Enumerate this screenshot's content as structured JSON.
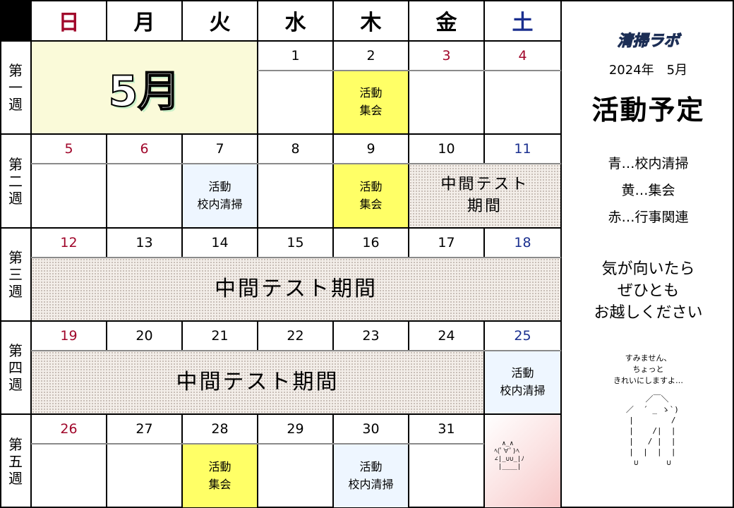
{
  "weekdays": [
    "日",
    "月",
    "火",
    "水",
    "木",
    "金",
    "土"
  ],
  "month_label": "5月",
  "week_labels": [
    [
      "第",
      "一",
      "週"
    ],
    [
      "第",
      "二",
      "週"
    ],
    [
      "第",
      "三",
      "週"
    ],
    [
      "第",
      "四",
      "週"
    ],
    [
      "第",
      "五",
      "週"
    ]
  ],
  "dates": {
    "w1": [
      "1",
      "2",
      "3",
      "4"
    ],
    "w2": [
      "5",
      "6",
      "7",
      "8",
      "9",
      "10",
      "11"
    ],
    "w3": [
      "12",
      "13",
      "14",
      "15",
      "16",
      "17",
      "18"
    ],
    "w4": [
      "19",
      "20",
      "21",
      "22",
      "23",
      "24",
      "25"
    ],
    "w5": [
      "26",
      "27",
      "28",
      "29",
      "30",
      "31"
    ]
  },
  "events": {
    "meeting": [
      "活動",
      "集会"
    ],
    "cleaning": [
      "活動",
      "校内清掃"
    ],
    "test_short": [
      "中間テスト",
      "期間"
    ],
    "test_long": "中間テスト期間"
  },
  "sidebar": {
    "brand": "清掃ラボ",
    "year_month": "2024年　5月",
    "title": "活動予定",
    "legend": [
      "青…校内清掃",
      "黄…集会",
      "赤…行事関連"
    ],
    "message": [
      "気が向いたら",
      "ぜひとも",
      "お越しください"
    ],
    "aa_speech": [
      "すみません、",
      "ちょっと",
      "きれいにしますよ…"
    ],
    "aa_figure": "     ／￣＼\n   ／  ´ _ ゝ`)\n   |        /\n   |    /|  |\n   |   / |  |\n   |  |  |  |\n   ∪      ∪",
    "aa_corner": "   ∧_∧\n ﾍ(ﾟ∀ﾟ)ﾍ\n ∠|_∪∪_|ﾉ\n  |____|"
  },
  "colors": {
    "sunday": "#a0062a",
    "saturday": "#1a2f8f",
    "meeting": "#ffff66",
    "cleaning": "#eef6ff"
  }
}
